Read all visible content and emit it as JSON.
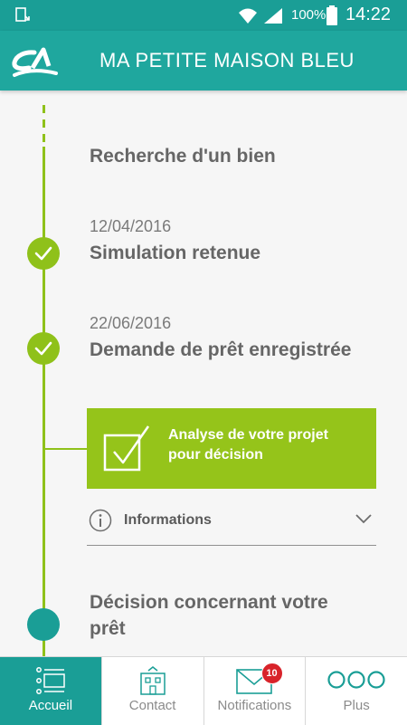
{
  "status_bar": {
    "battery_percent": "100%",
    "time": "14:22"
  },
  "header": {
    "title": "MA PETITE MAISON BLEU"
  },
  "timeline": {
    "steps": [
      {
        "date": "",
        "title": "Recherche d'un bien",
        "state": "done"
      },
      {
        "date": "12/04/2016",
        "title": "Simulation retenue",
        "state": "done"
      },
      {
        "date": "22/06/2016",
        "title": "Demande de prêt enregistrée",
        "state": "done"
      },
      {
        "title": "Analyse de votre projet pour décision",
        "state": "current"
      },
      {
        "title_line1": "Décision concernant votre",
        "title_line2": "prêt",
        "state": "pending"
      }
    ],
    "info_label": "Informations"
  },
  "bottom_nav": {
    "items": [
      {
        "label": "Accueil",
        "icon": "list-icon",
        "active": true
      },
      {
        "label": "Contact",
        "icon": "agency-building-icon",
        "active": false
      },
      {
        "label": "Notifications",
        "icon": "envelope-icon",
        "badge": "10",
        "active": false
      },
      {
        "label": "Plus",
        "icon": "more-dots-icon",
        "active": false
      }
    ]
  },
  "colors": {
    "primary_teal": "#1a9e96",
    "accent_green": "#95c41a",
    "badge_red": "#d8232a"
  }
}
